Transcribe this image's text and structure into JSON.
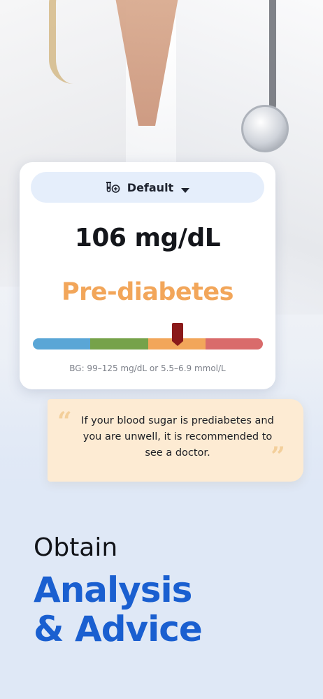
{
  "selector": {
    "label": "Default",
    "icon": "test-tubes-icon"
  },
  "reading": {
    "value": "106 mg/dL"
  },
  "status": {
    "label": "Pre-diabetes",
    "color": "#f2a65a"
  },
  "scale": {
    "segments": [
      {
        "color": "#5aa6d6"
      },
      {
        "color": "#76a24a"
      },
      {
        "color": "#f2a65a"
      },
      {
        "color": "#d96b6b"
      }
    ],
    "marker_fraction": 0.63,
    "marker_color": "#8b1a1a",
    "range_text": "BG: 99–125 mg/dL or 5.5–6.9 mmol/L"
  },
  "advice": {
    "text": "If your blood sugar is prediabetes and you are unwell, it is recommended to see a doctor.",
    "bubble_color": "#fdebd3",
    "quote_icon": "quote-marks-icon"
  },
  "headline": {
    "lead": "Obtain",
    "line1": "Analysis",
    "line2": "& Advice",
    "accent_color": "#1a5fd0"
  }
}
